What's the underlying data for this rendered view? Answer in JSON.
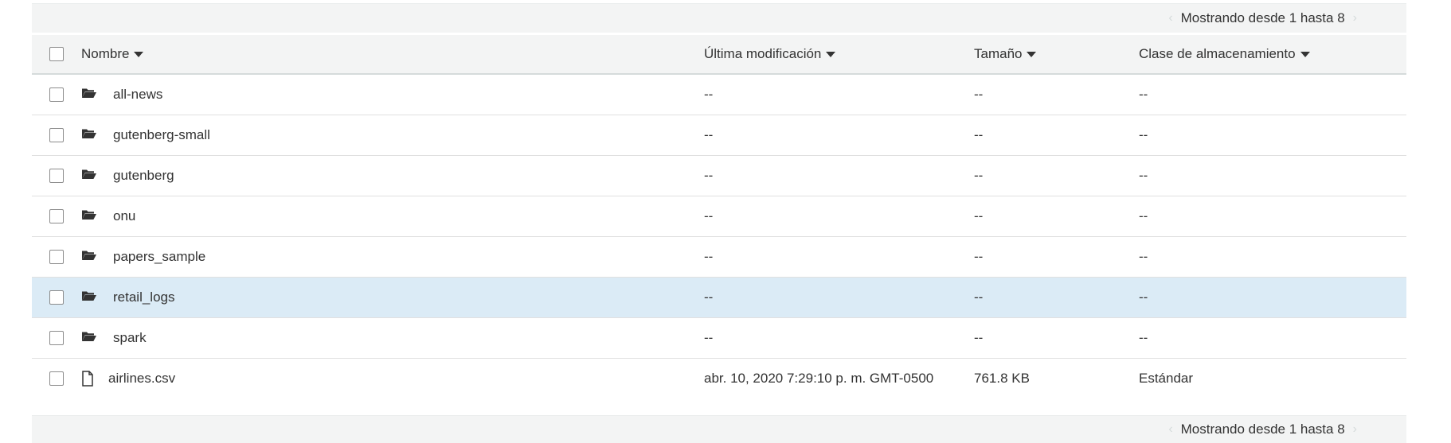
{
  "pagination": {
    "top_label": "Mostrando desde 1 hasta 8",
    "bottom_label": "Mostrando desde 1 hasta 8",
    "prev": "‹",
    "next": "›"
  },
  "table": {
    "columns": {
      "name": "Nombre",
      "modified": "Última modificación",
      "size": "Tamaño",
      "storage_class": "Clase de almacenamiento"
    },
    "rows": [
      {
        "type": "folder",
        "name": "all-news",
        "modified": "--",
        "size": "--",
        "storage_class": "--"
      },
      {
        "type": "folder",
        "name": "gutenberg-small",
        "modified": "--",
        "size": "--",
        "storage_class": "--"
      },
      {
        "type": "folder",
        "name": "gutenberg",
        "modified": "--",
        "size": "--",
        "storage_class": "--"
      },
      {
        "type": "folder",
        "name": "onu",
        "modified": "--",
        "size": "--",
        "storage_class": "--"
      },
      {
        "type": "folder",
        "name": "papers_sample",
        "modified": "--",
        "size": "--",
        "storage_class": "--"
      },
      {
        "type": "folder",
        "name": "retail_logs",
        "modified": "--",
        "size": "--",
        "storage_class": "--",
        "highlighted": true
      },
      {
        "type": "folder",
        "name": "spark",
        "modified": "--",
        "size": "--",
        "storage_class": "--"
      },
      {
        "type": "file",
        "name": "airlines.csv",
        "modified": "abr. 10, 2020 7:29:10 p. m. GMT-0500",
        "size": "761.8 KB",
        "storage_class": "Estándar"
      }
    ]
  },
  "colors": {
    "header_bg": "#f3f4f4",
    "highlight": "#dbebf6"
  }
}
